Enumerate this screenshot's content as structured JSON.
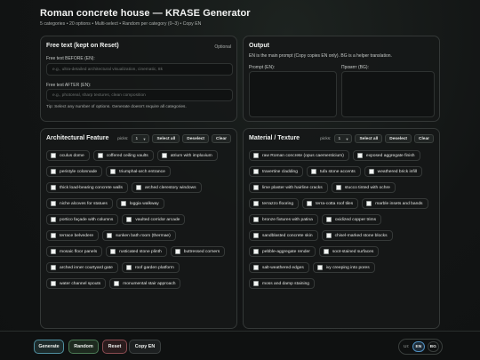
{
  "header": {
    "title": "Roman concrete house — KRASE Generator",
    "subtitle": "5 categories • 20 options • Multi-select • Random per category (0–3) • Copy EN"
  },
  "free_text": {
    "title": "Free text (kept on Reset)",
    "optional": "Optional",
    "before_label": "Free text BEFORE (EN):",
    "before_placeholder": "e.g., ultra-detailed architectural visualization, cinematic, 8k",
    "after_label": "Free text AFTER (EN):",
    "after_placeholder": "e.g., photoreal, sharp textures, clean composition",
    "tip": "Tip: Select any number of options. Generate doesn't require all categories."
  },
  "output": {
    "title": "Output",
    "description": "EN is the main prompt (Copy copies EN only). BG is a helper translation.",
    "prompt_en_label": "Prompt (EN):",
    "prompt_bg_label": "Промпт (BG):",
    "prompt_en_value": "",
    "prompt_bg_value": ""
  },
  "controls": {
    "picks_label": "picks:",
    "picks_value": "1",
    "select_all": "Select all",
    "deselect": "Deselect",
    "clear": "Clear"
  },
  "architectural": {
    "title": "Architectural Feature",
    "options": [
      "oculus dome",
      "coffered ceiling vaults",
      "atrium with impluvium",
      "peristyle colonnade",
      "triumphal-arch entrance",
      "thick load-bearing concrete walls",
      "arched clerestory windows",
      "niche alcoves for statues",
      "loggia walkway",
      "portico façade with columns",
      "vaulted corridor arcade",
      "terrace belvedere",
      "sunken bath room (thermae)",
      "mosaic floor panels",
      "rusticated stone plinth",
      "buttressed corners",
      "arched inner courtyard gate",
      "roof garden platform",
      "water channel spouts",
      "monumental stair approach"
    ]
  },
  "material": {
    "title": "Material / Texture",
    "options": [
      "raw Roman concrete (opus caementicium)",
      "exposed aggregate finish",
      "travertine cladding",
      "tufa stone accents",
      "weathered brick infill",
      "lime plaster with hairline cracks",
      "stucco tinted with ochre",
      "terrazzo flooring",
      "terra-cotta roof tiles",
      "marble insets and bands",
      "bronze fixtures with patina",
      "oxidized copper trims",
      "sandblasted concrete skin",
      "chisel-marked stone blocks",
      "pebble-aggregate render",
      "soot-stained surfaces",
      "salt-weathered edges",
      "ivy creeping into pores",
      "moss and damp staining"
    ]
  },
  "footer": {
    "generate": "Generate",
    "random": "Random",
    "reset": "Reset",
    "copy_en": "Copy EN",
    "ui_label": "UI:",
    "lang_en": "EN",
    "lang_bg": "BG",
    "active_lang": "EN"
  }
}
